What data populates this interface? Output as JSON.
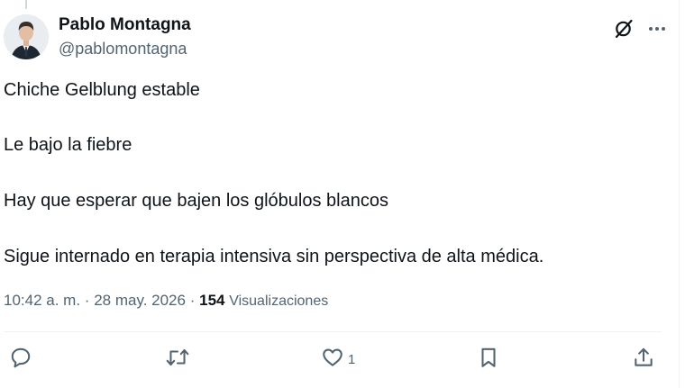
{
  "author": {
    "display_name": "Pablo Montagna",
    "handle": "@pablomontagna"
  },
  "icons": {
    "grok": "grok-icon",
    "more": "more-icon",
    "reply": "reply-icon",
    "repost": "repost-icon",
    "like": "heart-icon",
    "bookmark": "bookmark-icon",
    "share": "share-icon"
  },
  "post": {
    "paragraphs": [
      "Chiche Gelblung estable",
      "Le bajo la fiebre",
      "Hay que esperar que bajen los glóbulos blancos",
      "Sigue internado en terapia intensiva sin perspectiva de alta médica."
    ],
    "time": "10:42 a. m.",
    "separator": "·",
    "date": "28 may. 2026",
    "views_count": "154",
    "views_label": "Visualizaciones"
  },
  "engagement": {
    "likes": "1"
  },
  "colors": {
    "text": "#0f1419",
    "secondary": "#536471",
    "border": "#eff3f4"
  }
}
